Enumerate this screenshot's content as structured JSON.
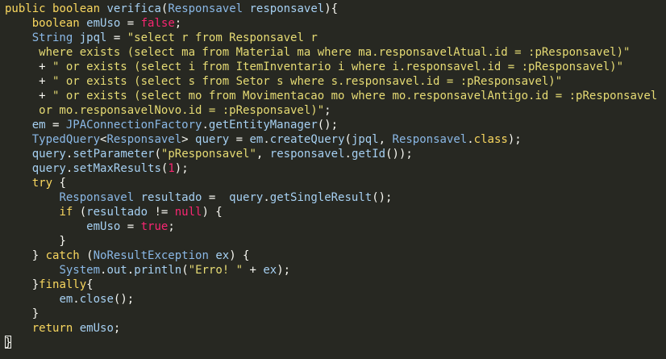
{
  "editor": {
    "lines": [
      [
        [
          "kw",
          "public"
        ],
        [
          "op",
          " "
        ],
        [
          "kw",
          "boolean"
        ],
        [
          "op",
          " "
        ],
        [
          "id",
          "verifica"
        ],
        [
          "op",
          "("
        ],
        [
          "ty",
          "Responsavel"
        ],
        [
          "op",
          " "
        ],
        [
          "id",
          "responsavel"
        ],
        [
          "op",
          ")"
        ],
        [
          "op",
          "{"
        ]
      ],
      [
        [
          "op",
          "    "
        ],
        [
          "kw",
          "boolean"
        ],
        [
          "op",
          " "
        ],
        [
          "id",
          "emUso"
        ],
        [
          "op",
          " = "
        ],
        [
          "lit",
          "false"
        ],
        [
          "op",
          ";"
        ]
      ],
      [
        [
          "op",
          "    "
        ],
        [
          "ty",
          "String"
        ],
        [
          "op",
          " "
        ],
        [
          "id",
          "jpql"
        ],
        [
          "op",
          " = "
        ],
        [
          "st",
          "\"select r from Responsavel r"
        ]
      ],
      [
        [
          "st",
          "     where exists (select ma from Material ma where ma.responsavelAtual.id = :pResponsavel)\""
        ]
      ],
      [
        [
          "op",
          "     + "
        ],
        [
          "st",
          "\" or exists (select i from ItemInventario i where i.responsavel.id = :pResponsavel)\""
        ]
      ],
      [
        [
          "op",
          "     + "
        ],
        [
          "st",
          "\" or exists (select s from Setor s where s.responsavel.id = :pResponsavel)\""
        ]
      ],
      [
        [
          "op",
          "     + "
        ],
        [
          "st",
          "\" or exists (select mo from Movimentacao mo where mo.responsavelAntigo.id = :pResponsavel"
        ]
      ],
      [
        [
          "st",
          "     or mo.responsavelNovo.id = :pResponsavel)\""
        ],
        [
          "op",
          ";"
        ]
      ],
      [
        [
          "op",
          "    "
        ],
        [
          "id",
          "em"
        ],
        [
          "op",
          " = "
        ],
        [
          "ty",
          "JPAConnectionFactory"
        ],
        [
          "op",
          "."
        ],
        [
          "id",
          "getEntityManager"
        ],
        [
          "op",
          "();"
        ]
      ],
      [
        [
          "op",
          "    "
        ],
        [
          "ty",
          "TypedQuery"
        ],
        [
          "op",
          "<"
        ],
        [
          "ty",
          "Responsavel"
        ],
        [
          "op",
          "> "
        ],
        [
          "id",
          "query"
        ],
        [
          "op",
          " = "
        ],
        [
          "id",
          "em"
        ],
        [
          "op",
          "."
        ],
        [
          "id",
          "createQuery"
        ],
        [
          "op",
          "("
        ],
        [
          "id",
          "jpql"
        ],
        [
          "op",
          ", "
        ],
        [
          "ty",
          "Responsavel"
        ],
        [
          "op",
          "."
        ],
        [
          "cls",
          "class"
        ],
        [
          "op",
          ");"
        ]
      ],
      [
        [
          "op",
          "    "
        ],
        [
          "id",
          "query"
        ],
        [
          "op",
          "."
        ],
        [
          "id",
          "setParameter"
        ],
        [
          "op",
          "("
        ],
        [
          "st",
          "\"pResponsavel\""
        ],
        [
          "op",
          ", "
        ],
        [
          "id",
          "responsavel"
        ],
        [
          "op",
          "."
        ],
        [
          "id",
          "getId"
        ],
        [
          "op",
          "());"
        ]
      ],
      [
        [
          "op",
          "    "
        ],
        [
          "id",
          "query"
        ],
        [
          "op",
          "."
        ],
        [
          "id",
          "setMaxResults"
        ],
        [
          "op",
          "("
        ],
        [
          "lit",
          "1"
        ],
        [
          "op",
          ");"
        ]
      ],
      [
        [
          "op",
          "    "
        ],
        [
          "kw",
          "try"
        ],
        [
          "op",
          " {"
        ]
      ],
      [
        [
          "op",
          "        "
        ],
        [
          "ty",
          "Responsavel"
        ],
        [
          "op",
          " "
        ],
        [
          "id",
          "resultado"
        ],
        [
          "op",
          " =  "
        ],
        [
          "id",
          "query"
        ],
        [
          "op",
          "."
        ],
        [
          "id",
          "getSingleResult"
        ],
        [
          "op",
          "();"
        ]
      ],
      [
        [
          "op",
          "        "
        ],
        [
          "kw",
          "if"
        ],
        [
          "op",
          " ("
        ],
        [
          "id",
          "resultado"
        ],
        [
          "op",
          " != "
        ],
        [
          "lit",
          "null"
        ],
        [
          "op",
          ") {"
        ]
      ],
      [
        [
          "op",
          "            "
        ],
        [
          "id",
          "emUso"
        ],
        [
          "op",
          " = "
        ],
        [
          "lit",
          "true"
        ],
        [
          "op",
          ";"
        ]
      ],
      [
        [
          "op",
          "        }"
        ]
      ],
      [
        [
          "op",
          "    } "
        ],
        [
          "kw",
          "catch"
        ],
        [
          "op",
          " ("
        ],
        [
          "ty",
          "NoResultException"
        ],
        [
          "op",
          " "
        ],
        [
          "id",
          "ex"
        ],
        [
          "op",
          ") {"
        ]
      ],
      [
        [
          "op",
          "        "
        ],
        [
          "ty",
          "System"
        ],
        [
          "op",
          "."
        ],
        [
          "id",
          "out"
        ],
        [
          "op",
          "."
        ],
        [
          "id",
          "println"
        ],
        [
          "op",
          "("
        ],
        [
          "st",
          "\"Erro! \""
        ],
        [
          "op",
          " + "
        ],
        [
          "id",
          "ex"
        ],
        [
          "op",
          ");"
        ]
      ],
      [
        [
          "op",
          "    }"
        ],
        [
          "kw",
          "finally"
        ],
        [
          "op",
          "{"
        ]
      ],
      [
        [
          "op",
          "        "
        ],
        [
          "id",
          "em"
        ],
        [
          "op",
          "."
        ],
        [
          "id",
          "close"
        ],
        [
          "op",
          "();"
        ]
      ],
      [
        [
          "op",
          "    }"
        ]
      ],
      [
        [
          "op",
          "    "
        ],
        [
          "kw",
          "return"
        ],
        [
          "op",
          " "
        ],
        [
          "id",
          "emUso"
        ],
        [
          "op",
          ";"
        ]
      ],
      [
        [
          "op",
          "}"
        ]
      ]
    ],
    "cursor_line": 23
  }
}
